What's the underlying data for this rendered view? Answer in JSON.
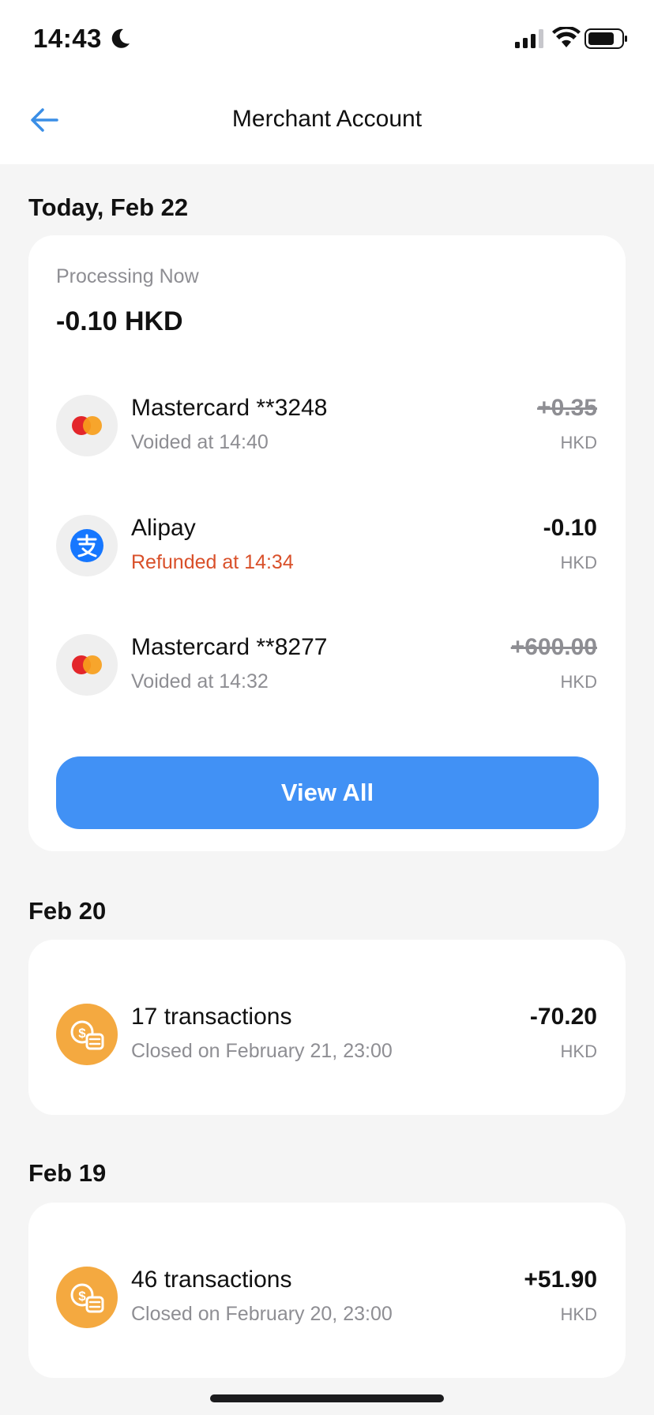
{
  "status_bar": {
    "time": "14:43"
  },
  "nav": {
    "title": "Merchant Account"
  },
  "today": {
    "header": "Today, Feb 22",
    "processing_label": "Processing Now",
    "processing_amount": "-0.10 HKD",
    "transactions": [
      {
        "title": "Mastercard **3248",
        "subtitle": "Voided at 14:40",
        "amount": "+0.35",
        "currency": "HKD",
        "icon": "mastercard-icon"
      },
      {
        "title": "Alipay",
        "subtitle": "Refunded at 14:34",
        "amount": "-0.10",
        "currency": "HKD",
        "icon": "alipay-icon"
      },
      {
        "title": "Mastercard **8277",
        "subtitle": "Voided at 14:32",
        "amount": "+600.00",
        "currency": "HKD",
        "icon": "mastercard-icon"
      }
    ],
    "view_all_label": "View All"
  },
  "feb20": {
    "header": "Feb 20",
    "title": "17 transactions",
    "subtitle": "Closed on February 21, 23:00",
    "amount": "-70.20",
    "currency": "HKD"
  },
  "feb19": {
    "header": "Feb 19",
    "title": "46 transactions",
    "subtitle": "Closed on February 20, 23:00",
    "amount": "+51.90",
    "currency": "HKD"
  },
  "colors": {
    "accent": "#4191f5",
    "refund": "#d9502a",
    "coin": "#f4a940",
    "mastercard_red": "#e3262b",
    "mastercard_orange": "#f79e1b",
    "alipay": "#1677ff"
  }
}
